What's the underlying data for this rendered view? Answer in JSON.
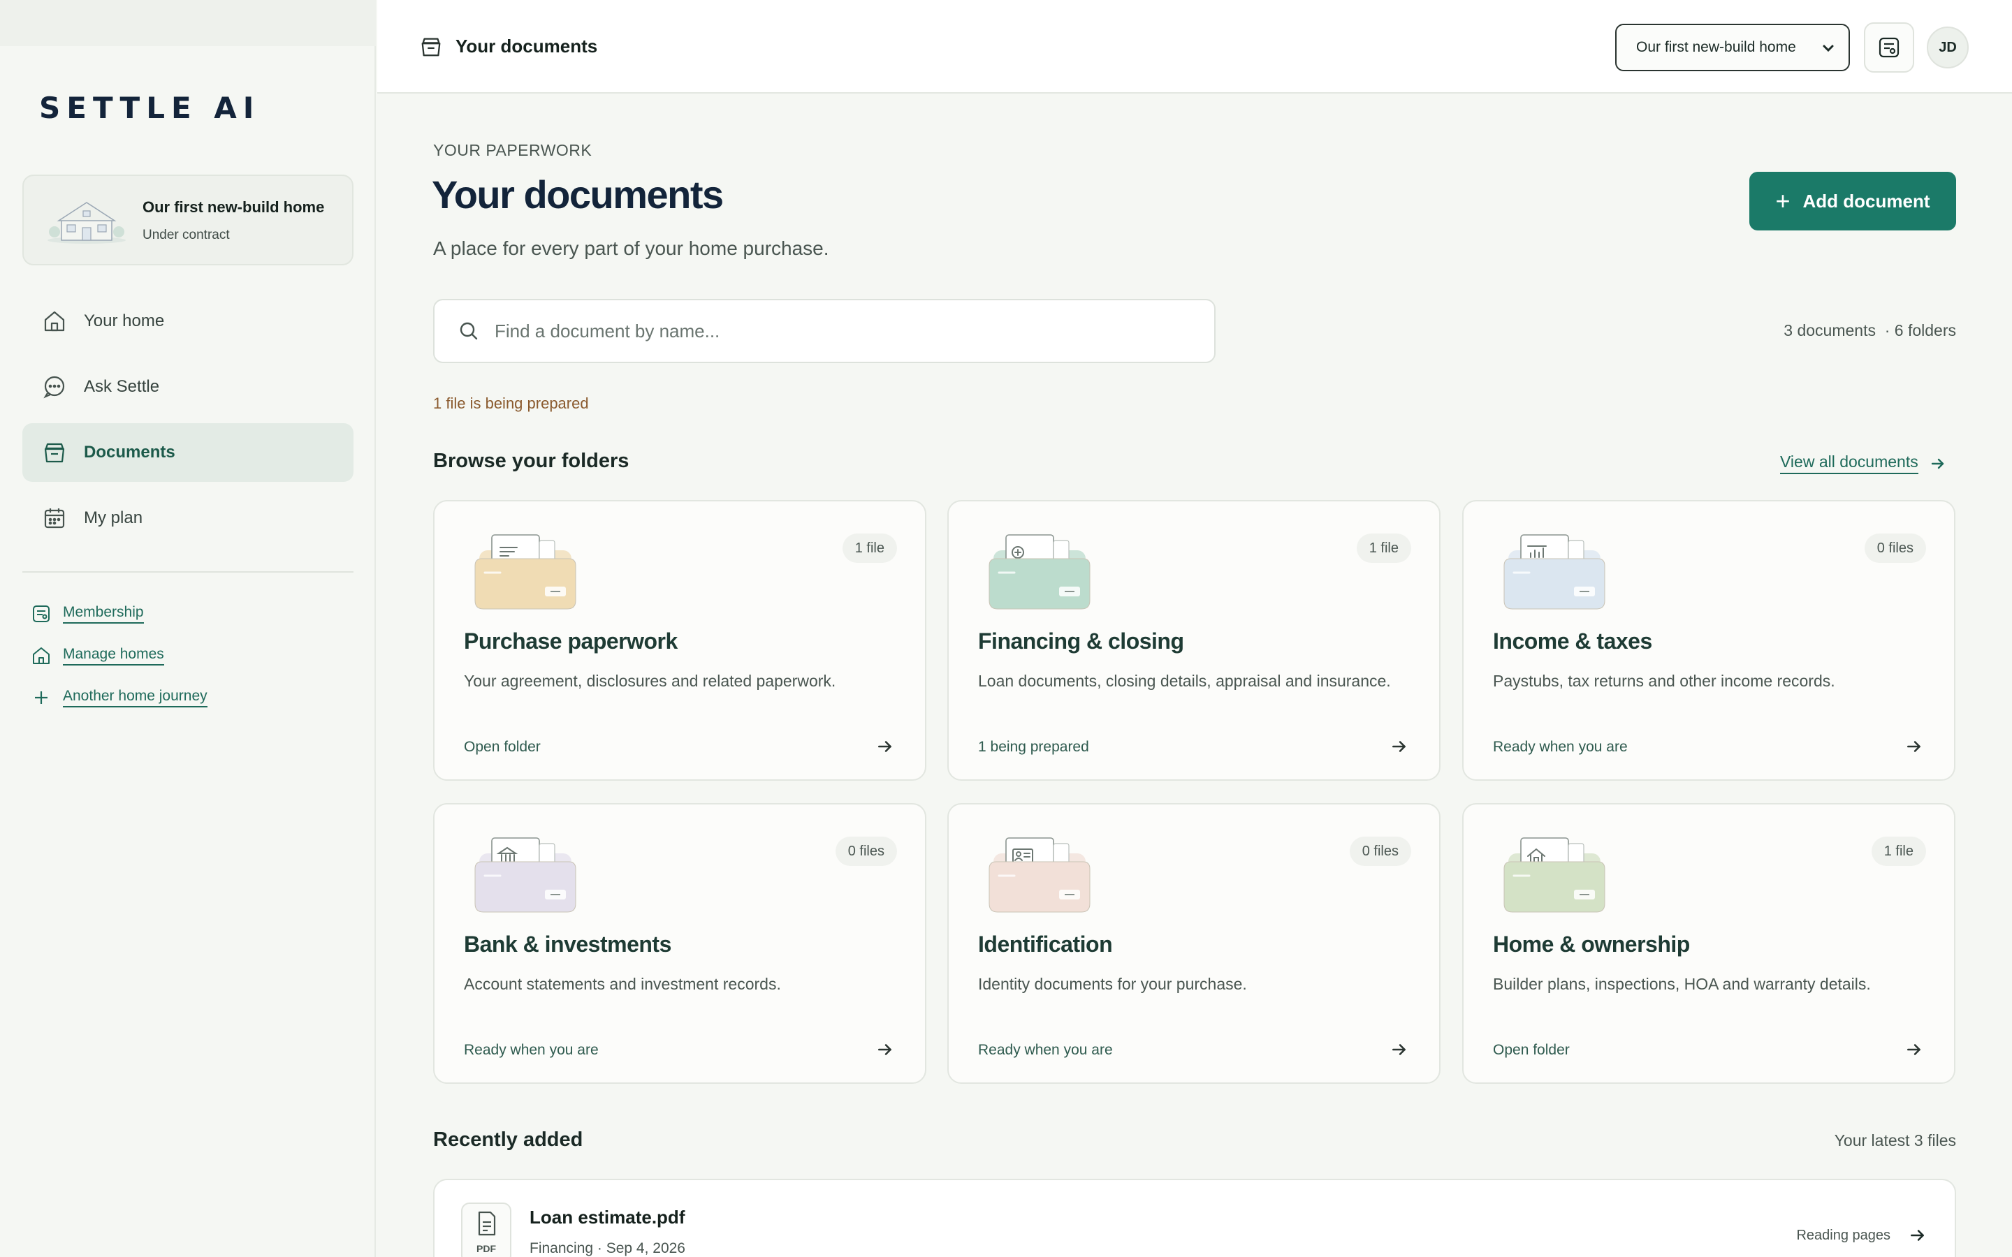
{
  "app": {
    "logo": "SETTLE AI"
  },
  "sidebar": {
    "home_card": {
      "title": "Our first new-build home",
      "status": "Under contract"
    },
    "nav": [
      {
        "label": "Your home",
        "icon": "home-icon",
        "active": false
      },
      {
        "label": "Ask Settle",
        "icon": "chat-bubble-icon",
        "active": false
      },
      {
        "label": "Documents",
        "icon": "document-stack-icon",
        "active": true
      },
      {
        "label": "My plan",
        "icon": "calendar-icon",
        "active": false
      }
    ],
    "links": [
      {
        "label": "Membership",
        "icon": "membership-card-icon"
      },
      {
        "label": "Manage homes",
        "icon": "home-icon"
      },
      {
        "label": "Another home journey",
        "icon": "plus-icon"
      }
    ]
  },
  "topbar": {
    "title": "Your documents",
    "home_select": {
      "selected": "Our first new-build home"
    },
    "avatar_initials": "JD"
  },
  "main": {
    "eyebrow": "YOUR PAPERWORK",
    "title": "Your documents",
    "subtitle": "A place for every part of your home purchase.",
    "add_button": "Add document",
    "search": {
      "placeholder": "Find a document by name...",
      "value": ""
    },
    "counts": "3 documents  · 6 folders",
    "preparing": "1 file is being prepared",
    "folders_heading": "Browse your folders",
    "view_all": "View all documents",
    "folders": [
      {
        "title": "Purchase paperwork",
        "count": "1 file",
        "desc": "Your agreement, disclosures and related paperwork.",
        "status": "Open folder",
        "color": "#f0dcb4"
      },
      {
        "title": "Financing & closing",
        "count": "1 file",
        "desc": "Loan documents, closing details, appraisal and insurance.",
        "status": "1 being prepared",
        "color": "#bcdccd"
      },
      {
        "title": "Income & taxes",
        "count": "0 files",
        "desc": "Paystubs, tax returns and other income records.",
        "status": "Ready when you are",
        "color": "#dbe6f0"
      },
      {
        "title": "Bank & investments",
        "count": "0 files",
        "desc": "Account statements and investment records.",
        "status": "Ready when you are",
        "color": "#e4e0ec"
      },
      {
        "title": "Identification",
        "count": "0 files",
        "desc": "Identity documents for your purchase.",
        "status": "Ready when you are",
        "color": "#f2e0d8"
      },
      {
        "title": "Home & ownership",
        "count": "1 file",
        "desc": "Builder plans, inspections, HOA and warranty details.",
        "status": "Open folder",
        "color": "#d4e2c6"
      }
    ],
    "recent_heading": "Recently added",
    "recent_note": "Your latest 3 files",
    "recent": [
      {
        "name": "Loan estimate.pdf",
        "meta": "Financing · Sep 4, 2026",
        "ext": "PDF",
        "status": "Reading pages"
      }
    ]
  },
  "colors": {
    "accent": "#1b7a68",
    "background": "#f5f7f3",
    "text": "#13243a"
  }
}
